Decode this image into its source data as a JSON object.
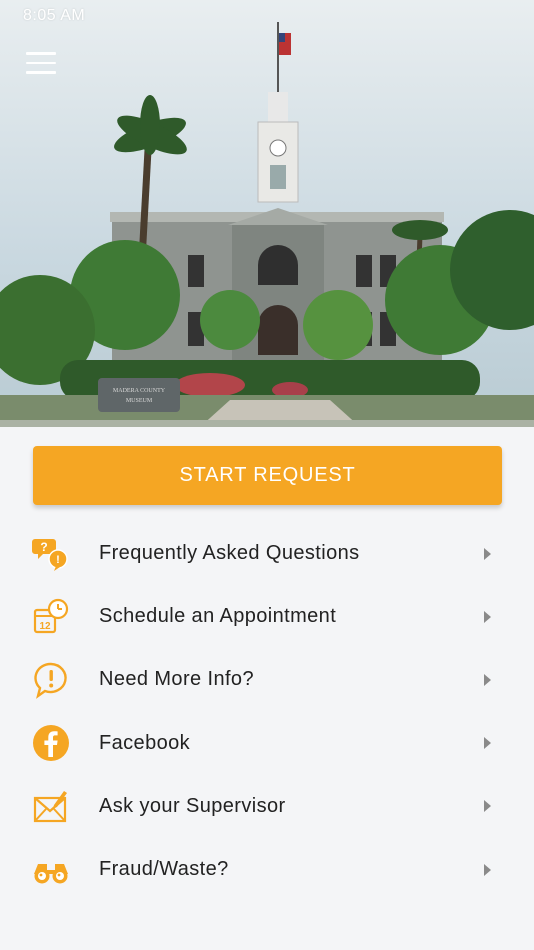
{
  "status_bar": {
    "time": "8:05 AM"
  },
  "header": {
    "menu_icon": "hamburger-menu-icon"
  },
  "hero": {
    "sign_line1": "MADERA COUNTY",
    "sign_line2": "MUSEUM"
  },
  "cta": {
    "label": "START REQUEST"
  },
  "menu": {
    "items": [
      {
        "label": "Frequently Asked Questions",
        "icon": "faq-bubbles-icon"
      },
      {
        "label": "Schedule an Appointment",
        "icon": "calendar-clock-icon"
      },
      {
        "label": "Need More Info?",
        "icon": "info-exclamation-icon"
      },
      {
        "label": "Facebook",
        "icon": "facebook-icon"
      },
      {
        "label": "Ask your Supervisor",
        "icon": "envelope-pen-icon"
      },
      {
        "label": "Fraud/Waste?",
        "icon": "binoculars-icon"
      }
    ]
  },
  "colors": {
    "accent": "#f5a623",
    "text": "#222222",
    "background": "#f4f5f7",
    "chevron": "#8a8a8a"
  }
}
